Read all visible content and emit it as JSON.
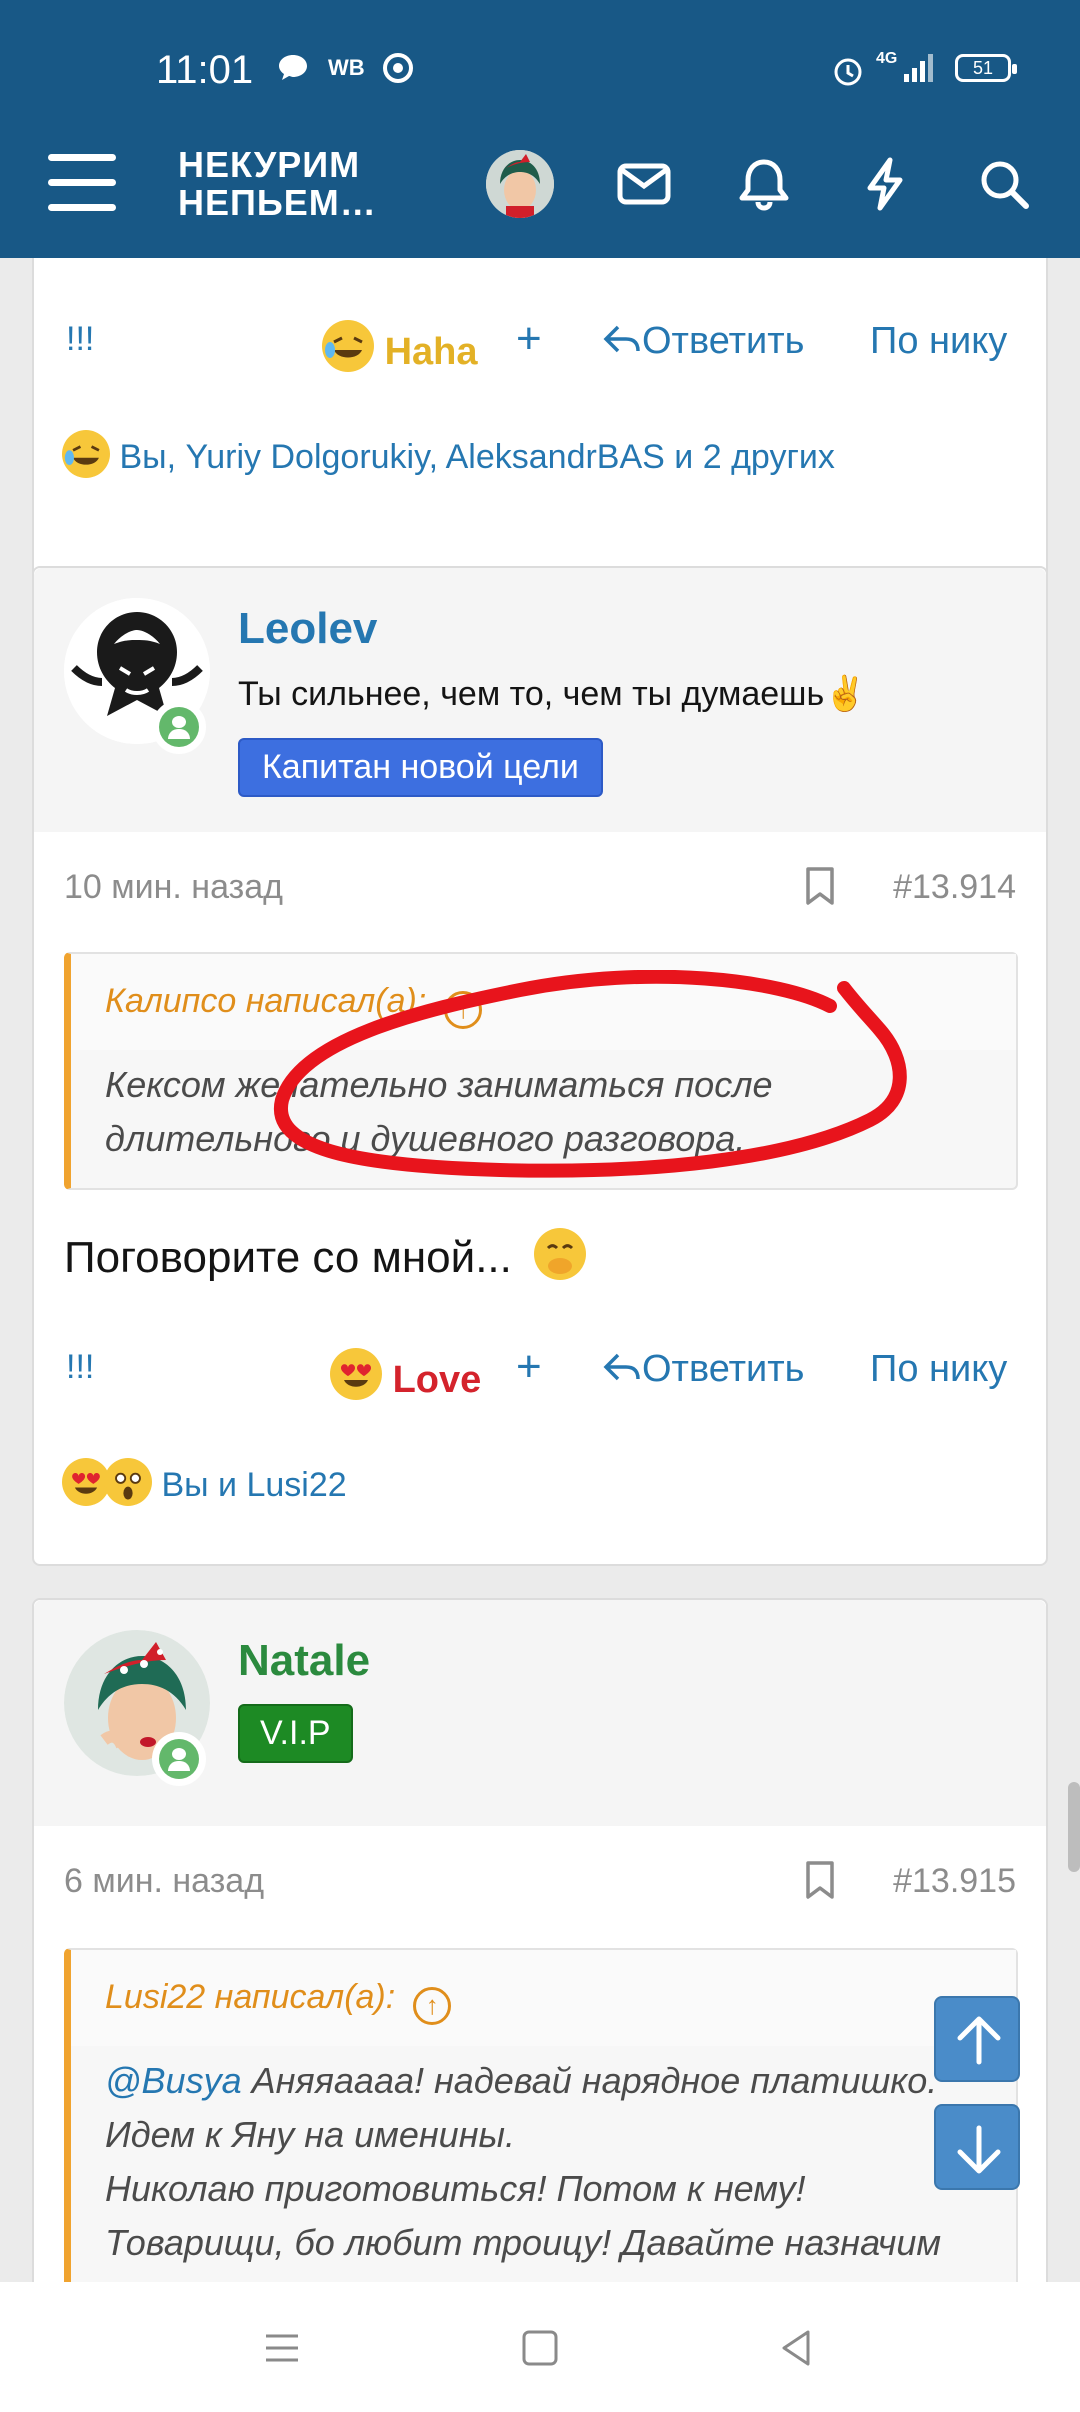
{
  "status_bar": {
    "time": "11:01",
    "icons": [
      "chat-bubble-icon",
      "wb-icon",
      "chrome-icon"
    ],
    "wb_label": "WB",
    "network_label": "4G",
    "battery": "51"
  },
  "header": {
    "brand_line1": "НЕКУРИМ",
    "brand_line2": "НЕПЬЕМ…",
    "icons": [
      "menu-icon",
      "user-avatar",
      "mail-icon",
      "bell-icon",
      "lightning-icon",
      "search-icon"
    ]
  },
  "prev_post": {
    "actions": {
      "bang": "!!!",
      "reaction": "Haha",
      "plus": "+",
      "reply": "Ответить",
      "by_nick": "По нику"
    },
    "reactions_text": "Вы, Yuriy Dolgorukiy, AleksandrBAS и 2 других"
  },
  "post1": {
    "username": "Leolev",
    "user_title": "Ты сильнее, чем то, чем ты думаешь✌️",
    "badge": "Капитан новой цели",
    "time": "10 мин. назад",
    "number": "#13.914",
    "quote": {
      "author": "Калипсо написал(а):",
      "text": "Кексом желательно заниматься после длительного и душевного разговора."
    },
    "message": "Поговорите со мной...",
    "actions": {
      "bang": "!!!",
      "reaction": "Love",
      "plus": "+",
      "reply": "Ответить",
      "by_nick": "По нику"
    },
    "reactions_text": "Вы и Lusi22"
  },
  "post2": {
    "username": "Natale",
    "badge": "V.I.P",
    "time": "6 мин. назад",
    "number": "#13.915",
    "quote": {
      "author": "Lusi22 написал(а):",
      "mention": "@Busya",
      "line1": " Аняяаааа! надевай нарядное платишко.",
      "line2": "Идем к Яну на именины.",
      "line3": "Николаю приготовиться! Потом к нему!",
      "line4": "Товарищи, бо любит троицу! Давайте назначим"
    }
  },
  "colors": {
    "header_bg": "#185886",
    "link": "#2577b1",
    "quote_accent": "#e08e1b",
    "love_red": "#d4232c",
    "haha_yellow": "#e3b126",
    "badge_blue": "#3d6fe0",
    "badge_green": "#1d8a24",
    "natale_green": "#2b8a3e",
    "annotation_red": "#e8141c"
  }
}
